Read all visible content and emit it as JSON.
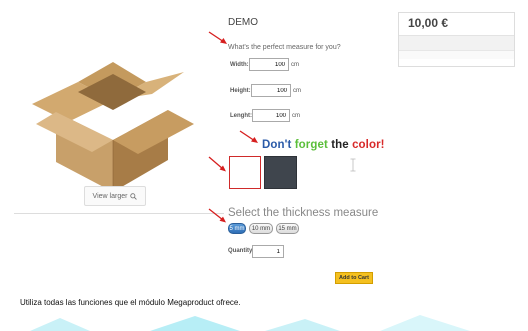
{
  "product": {
    "title": "DEMO",
    "question": "What's the perfect measure for you?",
    "view_larger": "View larger"
  },
  "dimensions": [
    {
      "label": "Width:",
      "value": "100",
      "unit": "cm"
    },
    {
      "label": "Height:",
      "value": "100",
      "unit": "cm"
    },
    {
      "label": "Lenght:",
      "value": "100",
      "unit": "cm"
    }
  ],
  "color_section": {
    "word1": "Don't",
    "word1_color": "#2a5aa8",
    "word2": "forget",
    "word2_color": "#5bbf3a",
    "word3": "the",
    "word3_color": "#222222",
    "word4": "color!",
    "word4_color": "#d82a2a",
    "swatches": [
      {
        "name": "White",
        "hex": "#ffffff"
      },
      {
        "name": "Gray",
        "hex": "#3b4149"
      }
    ]
  },
  "thickness": {
    "title": "Select the thickness measure",
    "options": [
      "5 mm",
      "10 mm",
      "15 mm"
    ],
    "selected": "5 mm"
  },
  "quantity": {
    "label": "Quantity:",
    "value": "1"
  },
  "cart": {
    "button": "Add to Cart"
  },
  "price": {
    "value": "10,00 €"
  },
  "footer": {
    "text": "Utiliza todas las funciones que el módulo Megaproduct ofrece."
  },
  "colors": {
    "accent": "#f4c020",
    "arrow": "#d61f1f",
    "selected_tab": "#3a7cc4"
  }
}
